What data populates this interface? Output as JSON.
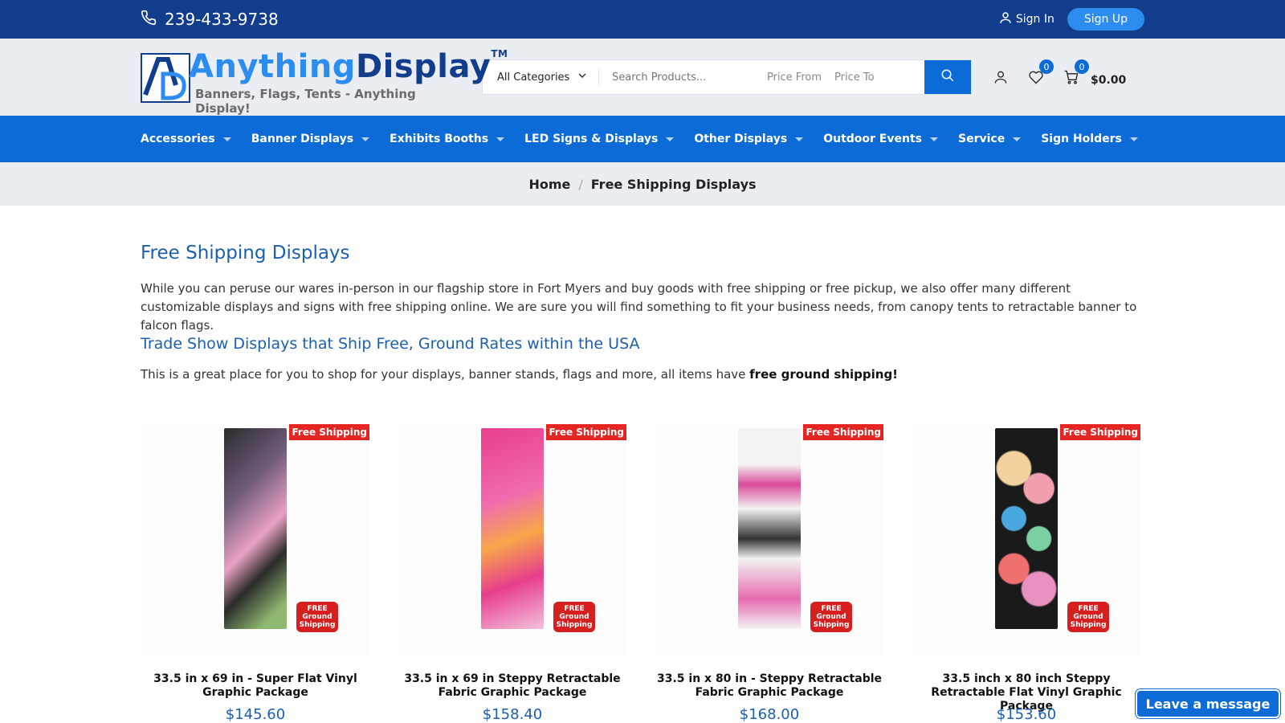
{
  "topbar": {
    "phone": "239-433-9738",
    "sign_in": "Sign In",
    "sign_up": "Sign Up"
  },
  "header": {
    "logo": {
      "word1": "Anything",
      "word2": "Display",
      "tm": "TM",
      "tagline": "Banners, Flags, Tents - Anything Display!"
    },
    "search": {
      "category": "All Categories",
      "placeholder": "Search Products...",
      "price_from": "Price From",
      "price_to": "Price To"
    },
    "wishlist_count": "0",
    "cart_count": "0",
    "cart_total": "$0.00"
  },
  "nav": {
    "items": [
      {
        "label": "Accessories"
      },
      {
        "label": "Banner Displays"
      },
      {
        "label": "Exhibits Booths"
      },
      {
        "label": "LED Signs & Displays"
      },
      {
        "label": "Other Displays"
      },
      {
        "label": "Outdoor Events"
      },
      {
        "label": "Service"
      },
      {
        "label": "Sign Holders"
      }
    ]
  },
  "breadcrumb": {
    "home": "Home",
    "separator": "/",
    "current": "Free Shipping Displays"
  },
  "content": {
    "title": "Free Shipping Displays",
    "intro": "While you can peruse our wares in-person in our flagship store in Fort Myers and buy goods with free shipping or free pickup, we also offer many different customizable displays and signs with free shipping online. We are sure you will find something to fit your business needs, from canopy tents to retractable banner to falcon flags.",
    "subtitle": "Trade Show Displays that Ship Free, Ground Rates within the USA",
    "note_text": "This is a great place for you to shop for your displays, banner stands, flags and more, all items have ",
    "note_bold": "free ground shipping!"
  },
  "products": [
    {
      "badge": "Free Shipping",
      "name": "33.5 in x 69 in - Super Flat Vinyl Graphic Package",
      "price": "$145.60",
      "stamp": "FREE Ground Shipping",
      "color": "#2b2b2b"
    },
    {
      "badge": "Free Shipping",
      "name": "33.5 in x 69 in Steppy Retractable Fabric Graphic Package",
      "price": "$158.40",
      "stamp": "FREE Ground Shipping",
      "color": "#e83e8c"
    },
    {
      "badge": "Free Shipping",
      "name": "33.5 in x 80 in - Steppy Retractable Fabric Graphic Package",
      "price": "$168.00",
      "stamp": "FREE Ground Shipping",
      "color": "#f3f3f3"
    },
    {
      "badge": "Free Shipping",
      "name": "33.5 inch x 80 inch Steppy Retractable Flat Vinyl Graphic Package",
      "price": "$153.60",
      "stamp": "FREE Ground Shipping",
      "color": "#1a1a1a"
    }
  ],
  "chat": {
    "label": "Leave a message"
  },
  "colors": {
    "topbar": "#123c8c",
    "nav": "#0d6bd8",
    "accent": "#2d8cf0",
    "badge_red": "#e52521",
    "title_blue": "#1b5fb0"
  }
}
